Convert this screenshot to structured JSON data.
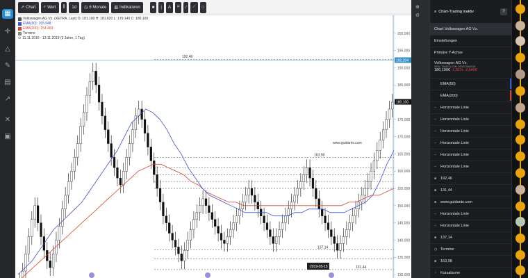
{
  "toolbar": {
    "chart_label": "Chart",
    "wert_label": "Wert",
    "interval_label": "1d",
    "range_label": "6 Monate",
    "indicators_label": "Indikatoren"
  },
  "legend": {
    "instrument": "Volkswagen AG Vz. (XETRA, Last) O: 181.100 H: 181.820 L: 179.140 C: 180.100",
    "ema50": "EMA(50): 165.948",
    "ema200": "EMA(200): 154.469",
    "termine": "Termine",
    "daterange": "11.11.2016 - 13.11.2019 (3 Jahre, 1 Tag)",
    "ema50_color": "#3b4fd1",
    "ema200_color": "#d9462b"
  },
  "chart_data": {
    "type": "candlestick",
    "ylim": [
      129,
      204
    ],
    "yticks": [
      "200,000",
      "195,000",
      "190,000",
      "185,000",
      "180,000",
      "175,000",
      "170,000",
      "165,000",
      "160,000",
      "155,000",
      "150,000",
      "145,000",
      "140,000",
      "135,000",
      "130,000"
    ],
    "ytick_values": [
      200,
      195,
      190,
      185,
      180,
      175,
      170,
      165,
      160,
      155,
      150,
      145,
      140,
      135,
      130
    ],
    "price_current": 180.1,
    "price_current_label": "180,100",
    "crosshair_price": 192.204,
    "crosshair_label": "192,204",
    "crosshair_date": "2019-05-15",
    "annotations": [
      {
        "text": "192,46",
        "price": 192.46
      },
      {
        "text": "163,98",
        "price": 163.98
      },
      {
        "text": "137,14",
        "price": 137.14
      },
      {
        "text": "131,44",
        "price": 131.44
      },
      {
        "text": "www.guidants.com",
        "price": 167.5
      }
    ],
    "horizontal_lines": [
      192.46,
      163.98,
      161.0,
      159.0,
      157.0,
      155.0,
      137.14,
      134.5,
      131.44
    ],
    "close_path": [
      128,
      131,
      136,
      141,
      146,
      150,
      145,
      141,
      137,
      134,
      132,
      136,
      140,
      144,
      149,
      153,
      157,
      160,
      164,
      168,
      173,
      177,
      182,
      186,
      189,
      185,
      180,
      176,
      172,
      168,
      164,
      161,
      158,
      156,
      160,
      164,
      168,
      172,
      176,
      178,
      175,
      171,
      167,
      163,
      159,
      155,
      151,
      147,
      145,
      142,
      140,
      138,
      136,
      134,
      137,
      140,
      143,
      146,
      148,
      150,
      152,
      150,
      148,
      146,
      144,
      142,
      140,
      139,
      141,
      143,
      145,
      147,
      149,
      151,
      153,
      155,
      153,
      151,
      149,
      147,
      145,
      143,
      141,
      139,
      141,
      143,
      145,
      147,
      149,
      151,
      153,
      155,
      157,
      159,
      161,
      158,
      155,
      152,
      149,
      147,
      145,
      143,
      141,
      139,
      137,
      139,
      141,
      143,
      145,
      147,
      149,
      151,
      153,
      155,
      157,
      160,
      163,
      166,
      169,
      172,
      175,
      178,
      180
    ],
    "ema50_path": [
      130,
      132,
      134,
      137,
      140,
      143,
      145,
      147,
      149,
      151,
      154,
      157,
      160,
      163,
      166,
      170,
      174,
      176,
      178,
      177,
      175,
      172,
      168,
      165,
      161,
      158,
      155,
      153,
      152,
      151,
      150,
      149,
      148,
      148,
      148,
      148,
      147,
      147,
      147,
      148,
      148,
      149,
      149,
      149,
      148,
      148,
      148,
      149,
      150,
      151,
      153,
      157,
      162,
      166
    ],
    "ema200_path": [
      128,
      130,
      132,
      134,
      136,
      138,
      140,
      142,
      144,
      146,
      148,
      150,
      152,
      154,
      156,
      158,
      160,
      161,
      162,
      162,
      161,
      160,
      159,
      157,
      156,
      154,
      153,
      152,
      151,
      151,
      150,
      150,
      150,
      150,
      150,
      150,
      150,
      150,
      150,
      150,
      150,
      150,
      150,
      150,
      151,
      151,
      152,
      153,
      153,
      154,
      155
    ]
  },
  "panel": {
    "header": "Chart-Trading inaktiv",
    "help": "?",
    "items": [
      "Chart Volkswagen AG Vz.",
      "Einstellungen",
      "Primäre Y-Achse"
    ],
    "stock": {
      "name": "Volkswagen AG Vz.",
      "wkn": "WKN: 766403 | ISIN: DE0007664039",
      "price": "180,100€",
      "change_pct": "-1,51%",
      "change_abs": "-2,640€"
    },
    "list": [
      {
        "icon": "",
        "label": "EMA(50)"
      },
      {
        "icon": "",
        "label": "EMA(200)"
      },
      {
        "icon": "–",
        "label": "Horizontale Linie"
      },
      {
        "icon": "–",
        "label": "Horizontale Linie"
      },
      {
        "icon": "–",
        "label": "Horizontale Linie"
      },
      {
        "icon": "–",
        "label": "Horizontale Linie"
      },
      {
        "icon": "–",
        "label": "Horizontale Linie"
      },
      {
        "icon": "–",
        "label": "Horizontale Linie"
      },
      {
        "icon": "■",
        "label": "192,46"
      },
      {
        "icon": "■",
        "label": "131,44"
      },
      {
        "icon": "■",
        "label": "www.guidants.com"
      },
      {
        "icon": "–",
        "label": "Horizontale Linie"
      },
      {
        "icon": "–",
        "label": "Horizontale Linie"
      },
      {
        "icon": "■",
        "label": "137,14"
      },
      {
        "icon": "◷",
        "label": "Termine"
      },
      {
        "icon": "■",
        "label": "163,98"
      },
      {
        "icon": "◔",
        "label": "Kursalarme"
      }
    ]
  }
}
